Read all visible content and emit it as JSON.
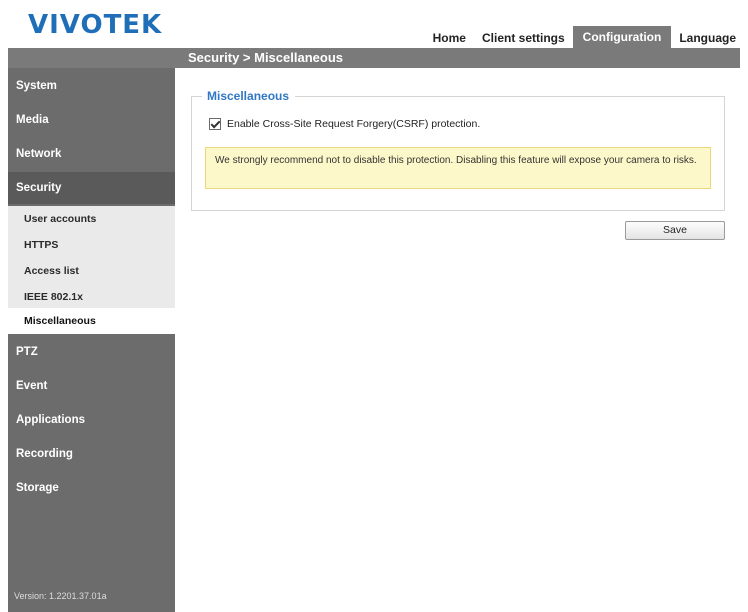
{
  "brand": {
    "logo_text": "VIVOTEK",
    "logo_color": "#1f6fb8"
  },
  "topnav": {
    "tabs": [
      {
        "label": "Home",
        "active": false
      },
      {
        "label": "Client settings",
        "active": false
      },
      {
        "label": "Configuration",
        "active": true
      },
      {
        "label": "Language",
        "active": false
      }
    ]
  },
  "titlebar": {
    "breadcrumb": "Security  > Miscellaneous"
  },
  "sidebar": {
    "items": [
      {
        "label": "System"
      },
      {
        "label": "Media"
      },
      {
        "label": "Network"
      },
      {
        "label": "Security",
        "selected": true
      },
      {
        "label": "PTZ"
      },
      {
        "label": "Event"
      },
      {
        "label": "Applications"
      },
      {
        "label": "Recording"
      },
      {
        "label": "Storage"
      }
    ],
    "security_submenu": [
      {
        "label": "User accounts"
      },
      {
        "label": "HTTPS"
      },
      {
        "label": "Access list"
      },
      {
        "label": "IEEE 802.1x"
      },
      {
        "label": "Miscellaneous",
        "current": true
      }
    ],
    "version": "Version: 1.2201.37.01a"
  },
  "main": {
    "section_title": "Miscellaneous",
    "csrf_option": {
      "label": "Enable Cross-Site Request Forgery(CSRF) protection.",
      "checked": true
    },
    "warning_text": "We strongly recommend not to disable this protection. Disabling this feature will expose your camera to risks.",
    "save_label": "Save"
  },
  "colors": {
    "accent": "#2f78c4",
    "sidebar_bg": "#6c6c6c",
    "submenu_bg": "#eaeaea",
    "warning_bg": "#fdf8c9"
  }
}
